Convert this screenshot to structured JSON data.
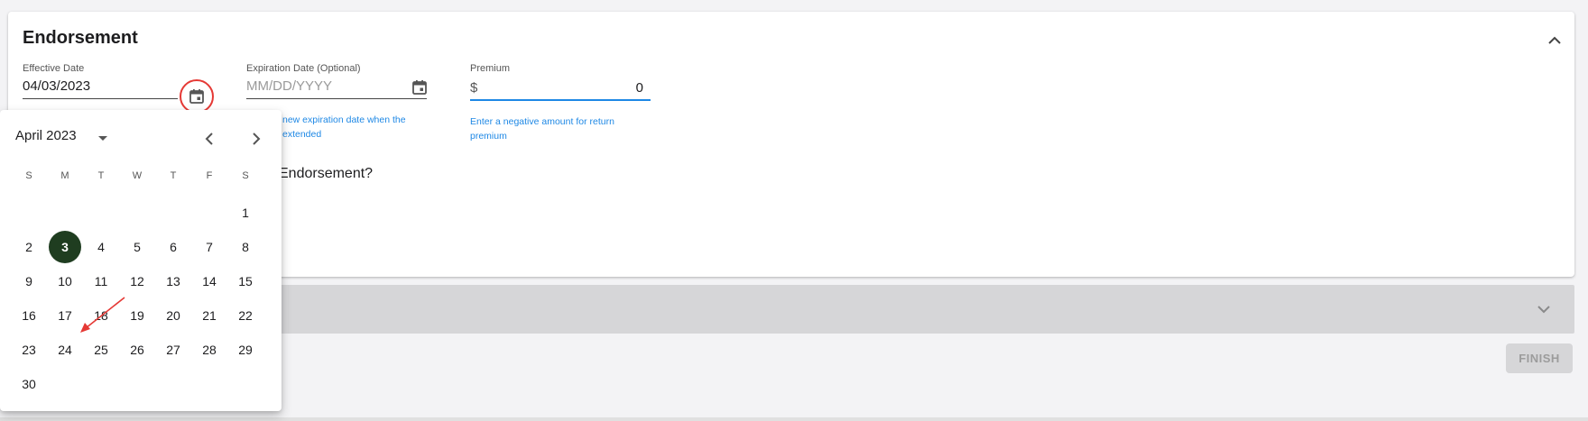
{
  "endorsement": {
    "title": "Endorsement",
    "effective_date": {
      "label": "Effective Date",
      "value": "04/03/2023"
    },
    "expiration_date": {
      "label": "Expiration Date (Optional)",
      "placeholder": "MM/DD/YYYY",
      "helper_line1": "new expiration date when the",
      "helper_line2": "extended"
    },
    "premium": {
      "label": "Premium",
      "currency": "$",
      "value": "0",
      "helper_line1": "Enter a negative amount for return",
      "helper_line2": "premium"
    },
    "question_text": "Endorsement?"
  },
  "actions": {
    "finish_label": "FINISH"
  },
  "datepicker": {
    "month_year": "April 2023",
    "weekdays": [
      "S",
      "M",
      "T",
      "W",
      "T",
      "F",
      "S"
    ],
    "weeks": [
      [
        "",
        "",
        "",
        "",
        "",
        "",
        "1"
      ],
      [
        "2",
        "3",
        "4",
        "5",
        "6",
        "7",
        "8"
      ],
      [
        "9",
        "10",
        "11",
        "12",
        "13",
        "14",
        "15"
      ],
      [
        "16",
        "17",
        "18",
        "19",
        "20",
        "21",
        "22"
      ],
      [
        "23",
        "24",
        "25",
        "26",
        "27",
        "28",
        "29"
      ],
      [
        "30",
        "",
        "",
        "",
        "",
        "",
        ""
      ]
    ],
    "selected_day": "3"
  },
  "colors": {
    "accent_blue": "#1e88e5",
    "selected_day_bg": "#1f3d20",
    "annotation_red": "#e53935"
  },
  "icons": {
    "calendar": "calendar-icon",
    "collapse": "chevron-up-icon",
    "expand": "chevron-down-icon",
    "prev": "chevron-left-icon",
    "next": "chevron-right-icon",
    "dropdown": "caret-down-icon"
  }
}
